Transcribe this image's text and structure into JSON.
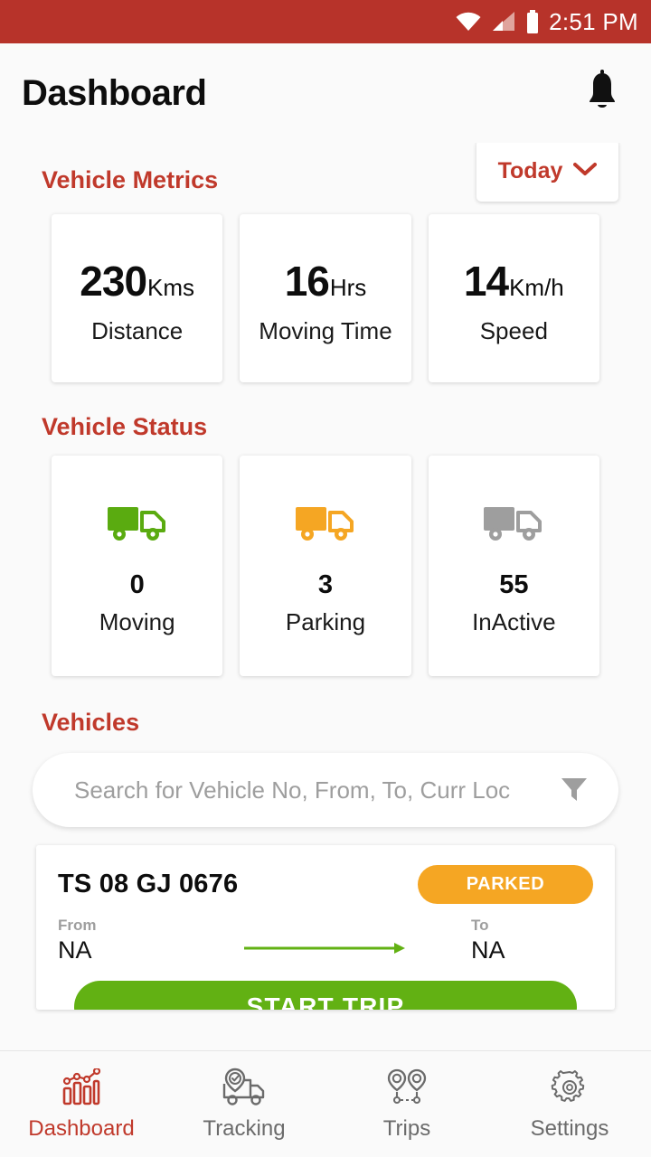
{
  "statusbar": {
    "time": "2:51 PM",
    "icons": [
      "wifi-icon",
      "cellular-signal-icon",
      "battery-icon"
    ],
    "background": "#b7332a"
  },
  "appbar": {
    "title": "Dashboard",
    "notification_icon": "bell-icon"
  },
  "metrics_section": {
    "title": "Vehicle Metrics",
    "range_selector": {
      "label": "Today",
      "icon": "chevron-down-icon"
    },
    "cards": [
      {
        "value": "230",
        "unit": "Kms",
        "label": "Distance"
      },
      {
        "value": "16",
        "unit": "Hrs",
        "label": "Moving Time"
      },
      {
        "value": "14",
        "unit": "Km/h",
        "label": "Speed"
      }
    ]
  },
  "status_section": {
    "title": "Vehicle Status",
    "cards": [
      {
        "icon": "truck-icon",
        "count": "0",
        "label": "Moving",
        "color": "#5aab10"
      },
      {
        "icon": "truck-icon",
        "count": "3",
        "label": "Parking",
        "color": "#f5a623"
      },
      {
        "icon": "truck-icon",
        "count": "55",
        "label": "InActive",
        "color": "#9e9e9e"
      }
    ]
  },
  "vehicles_section": {
    "title": "Vehicles",
    "search": {
      "placeholder": "Search for Vehicle No, From, To, Curr Loc",
      "value": "",
      "filter_icon": "filter-funnel-icon"
    },
    "list": [
      {
        "vehicle_no": "TS 08 GJ 0676",
        "status_badge": "PARKED",
        "badge_color": "#f5a623",
        "from_label": "From",
        "from_value": "NA",
        "to_label": "To",
        "to_value": "NA",
        "arrow_icon": "arrow-right-icon",
        "action_label": "START TRIP",
        "action_color": "#62b113"
      }
    ]
  },
  "bottom_nav": {
    "active_color": "#c0392b",
    "items": [
      {
        "label": "Dashboard",
        "icon": "bar-chart-icon",
        "active": true
      },
      {
        "label": "Tracking",
        "icon": "truck-pin-icon",
        "active": false
      },
      {
        "label": "Trips",
        "icon": "route-pins-icon",
        "active": false
      },
      {
        "label": "Settings",
        "icon": "gear-icon",
        "active": false
      }
    ]
  }
}
